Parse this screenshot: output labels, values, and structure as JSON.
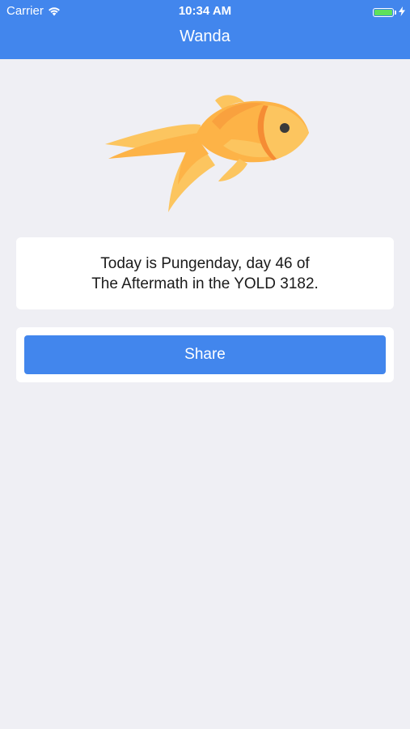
{
  "status_bar": {
    "carrier": "Carrier",
    "time": "10:34 AM",
    "wifi_icon": "wifi-icon",
    "battery_icon": "battery-icon",
    "charging_icon": "charging-bolt-icon",
    "battery_level": 1.0
  },
  "nav": {
    "title": "Wanda"
  },
  "hero": {
    "icon": "goldfish-icon",
    "colors": [
      "#fcc55f",
      "#fdb347",
      "#f58c34"
    ]
  },
  "info": {
    "line1": "Today is Pungenday, day 46 of",
    "line2": "The Aftermath in the YOLD 3182."
  },
  "actions": {
    "share_label": "Share"
  },
  "colors": {
    "accent": "#4286ed",
    "background": "#efeff4",
    "card": "#ffffff"
  }
}
